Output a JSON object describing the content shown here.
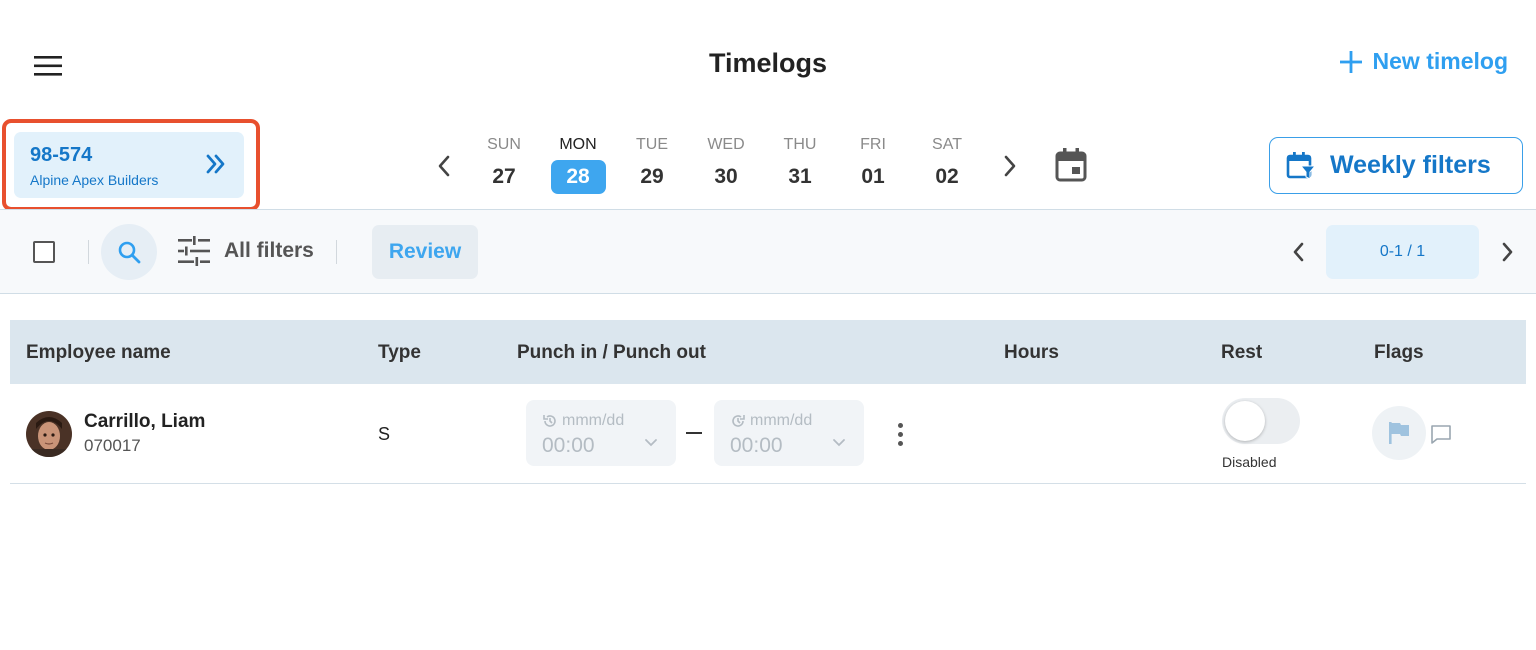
{
  "header": {
    "title": "Timelogs",
    "new_label": "New timelog"
  },
  "company": {
    "code": "98-574",
    "name": "Alpine Apex Builders"
  },
  "week": {
    "days": [
      {
        "label": "SUN",
        "num": "27",
        "active": false
      },
      {
        "label": "MON",
        "num": "28",
        "active": true
      },
      {
        "label": "TUE",
        "num": "29",
        "active": false
      },
      {
        "label": "WED",
        "num": "30",
        "active": false
      },
      {
        "label": "THU",
        "num": "31",
        "active": false
      },
      {
        "label": "FRI",
        "num": "01",
        "active": false
      },
      {
        "label": "SAT",
        "num": "02",
        "active": false
      }
    ],
    "weekly_filters_label": "Weekly filters"
  },
  "toolbar": {
    "all_filters_label": "All filters",
    "review_label": "Review",
    "pagination": "0-1 / 1"
  },
  "table": {
    "columns": [
      "Employee name",
      "Type",
      "Punch in / Punch out",
      "Hours",
      "Rest",
      "Flags"
    ],
    "rows": [
      {
        "name": "Carrillo, Liam",
        "id": "070017",
        "type": "S",
        "punch_in": {
          "date_placeholder": "mmm/dd",
          "time_placeholder": "00:00"
        },
        "punch_out": {
          "date_placeholder": "mmm/dd",
          "time_placeholder": "00:00"
        },
        "rest_status": "Disabled"
      }
    ]
  },
  "colors": {
    "accent": "#3ea6ef",
    "brand_dark": "#1577c8",
    "highlight_frame": "#e8502e"
  }
}
